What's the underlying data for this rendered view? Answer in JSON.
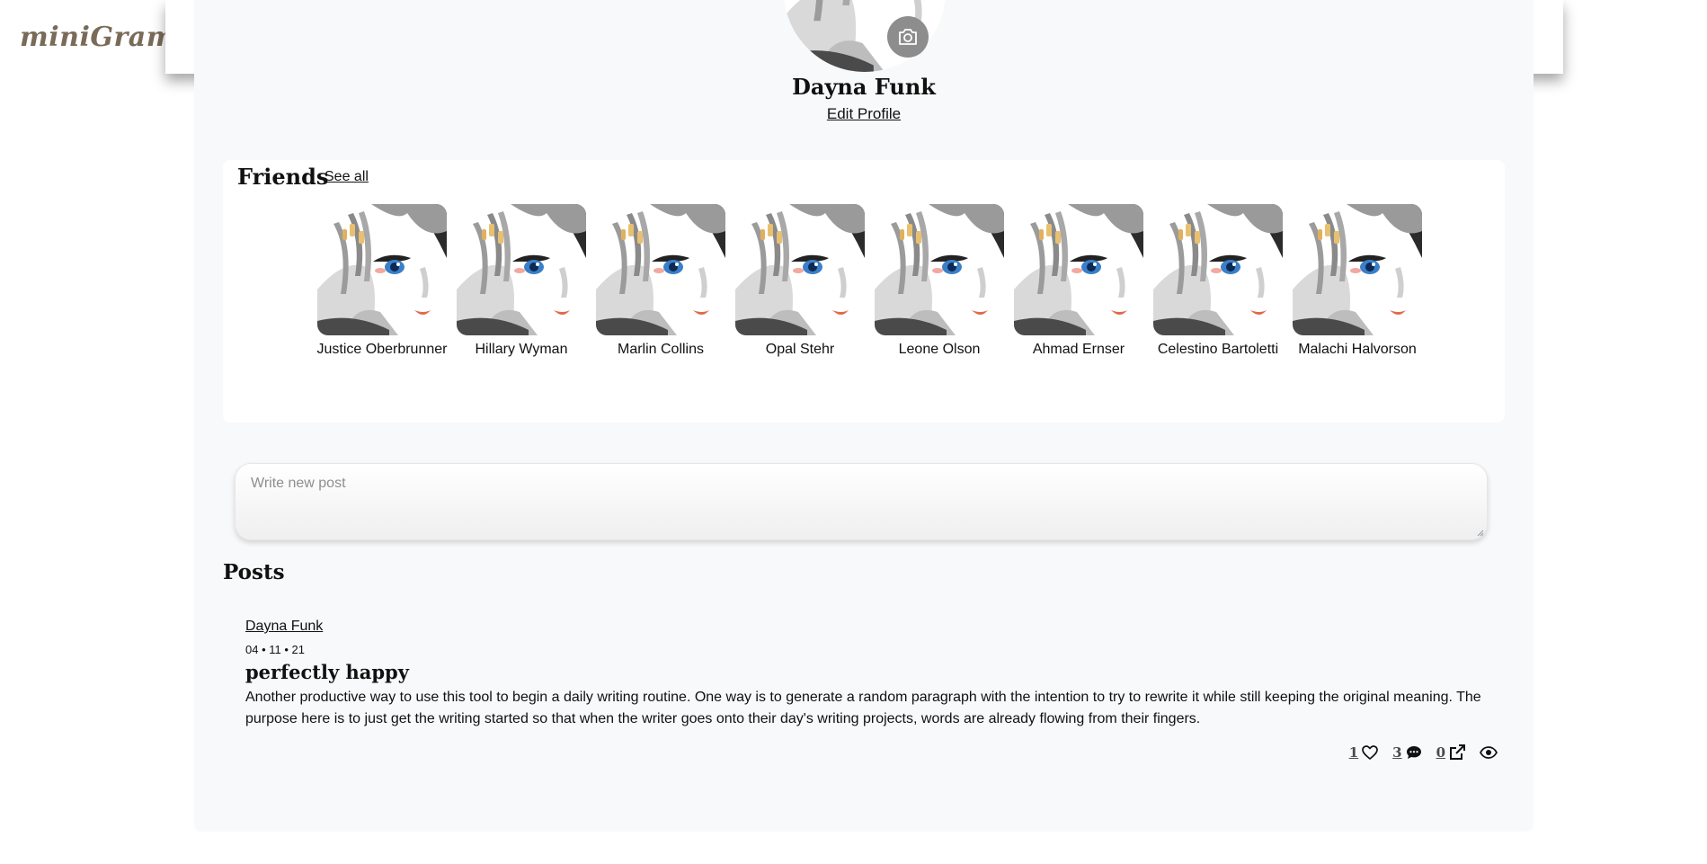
{
  "app": {
    "logo": "miniGram"
  },
  "profile": {
    "name": "Dayna Funk",
    "edit_label": "Edit Profile"
  },
  "friends": {
    "title": "Friends",
    "see_all": "See all",
    "list": [
      {
        "name": "Justice Oberbrunner"
      },
      {
        "name": "Hillary Wyman"
      },
      {
        "name": "Marlin Collins"
      },
      {
        "name": "Opal Stehr"
      },
      {
        "name": "Leone Olson"
      },
      {
        "name": "Ahmad Ernser"
      },
      {
        "name": "Celestino Bartoletti"
      },
      {
        "name": "Malachi Halvorson"
      }
    ]
  },
  "composer": {
    "placeholder": "Write new post"
  },
  "posts": {
    "title": "Posts",
    "items": [
      {
        "author": "Dayna Funk",
        "date": "04 • 11 • 21",
        "title": "perfectly happy",
        "body": "Another productive way to use this tool to begin a daily writing routine. One way is to generate a random paragraph with the intention to try to rewrite it while still keeping the original meaning. The purpose here is to just get the writing started so that when the writer goes onto their day's writing projects, words are already flowing from their fingers.",
        "likes": "1",
        "comments": "3",
        "shares": "0"
      }
    ]
  },
  "icons": {
    "camera": "camera-icon",
    "like": "heart-icon",
    "comment": "comment-icon",
    "share": "share-icon",
    "view": "eye-icon"
  }
}
